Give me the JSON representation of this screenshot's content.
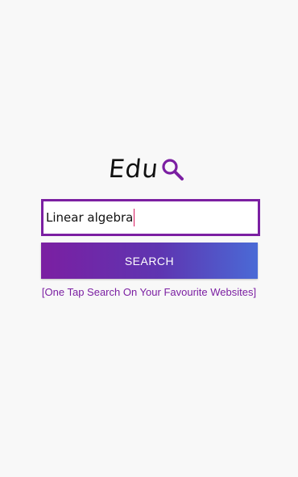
{
  "logo": {
    "text": "Edu",
    "icon": "magnifier-icon",
    "icon_color": "#7b1fa2"
  },
  "search": {
    "value": "Linear algebra",
    "border_color": "#7b1fa2"
  },
  "search_button": {
    "label": "SEARCH",
    "gradient_start": "#7b1fa2",
    "gradient_end": "#4a6ad6"
  },
  "tagline": {
    "text": "[One Tap Search On Your Favourite Websites]",
    "color": "#7b1fa2"
  }
}
